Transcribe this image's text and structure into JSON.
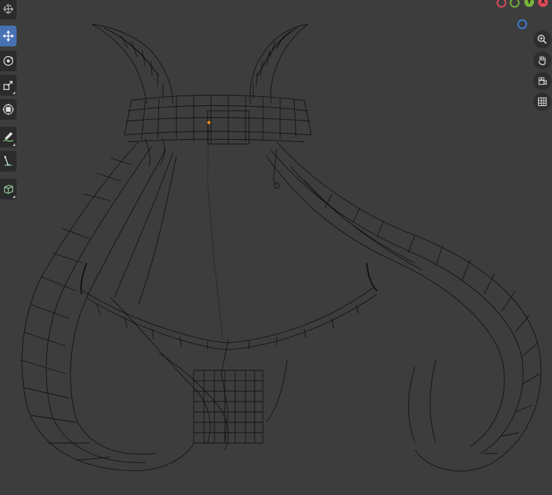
{
  "viewport": {
    "background": "#3d3d3d",
    "wire_color": "#111111"
  },
  "toolbar": {
    "tools": [
      {
        "name": "cursor-tool",
        "icon": "cursor-icon"
      },
      {
        "name": "move-tool",
        "icon": "move-icon",
        "active": true
      },
      {
        "name": "rotate-tool",
        "icon": "rotate-icon"
      },
      {
        "name": "scale-tool",
        "icon": "scale-icon"
      },
      {
        "name": "transform-tool",
        "icon": "transform-icon"
      },
      {
        "name": "annotate-tool",
        "icon": "annotate-icon"
      },
      {
        "name": "measure-tool",
        "icon": "measure-icon"
      },
      {
        "name": "add-cube-tool",
        "icon": "cube-icon"
      }
    ],
    "active_color": "#4772b3"
  },
  "gizmo": {
    "x_axis": {
      "label": "X",
      "color": "#e04a5a"
    },
    "y_axis": {
      "label": "Y",
      "color": "#7ab33a"
    },
    "z_axis": {
      "label": "Z",
      "color": "#3d7bd6"
    },
    "nav_buttons": [
      {
        "name": "zoom-button",
        "icon": "zoom-in-icon"
      },
      {
        "name": "pan-button",
        "icon": "hand-icon"
      },
      {
        "name": "camera-view-button",
        "icon": "camera-icon"
      },
      {
        "name": "ortho-toggle-button",
        "icon": "grid-icon"
      }
    ]
  }
}
